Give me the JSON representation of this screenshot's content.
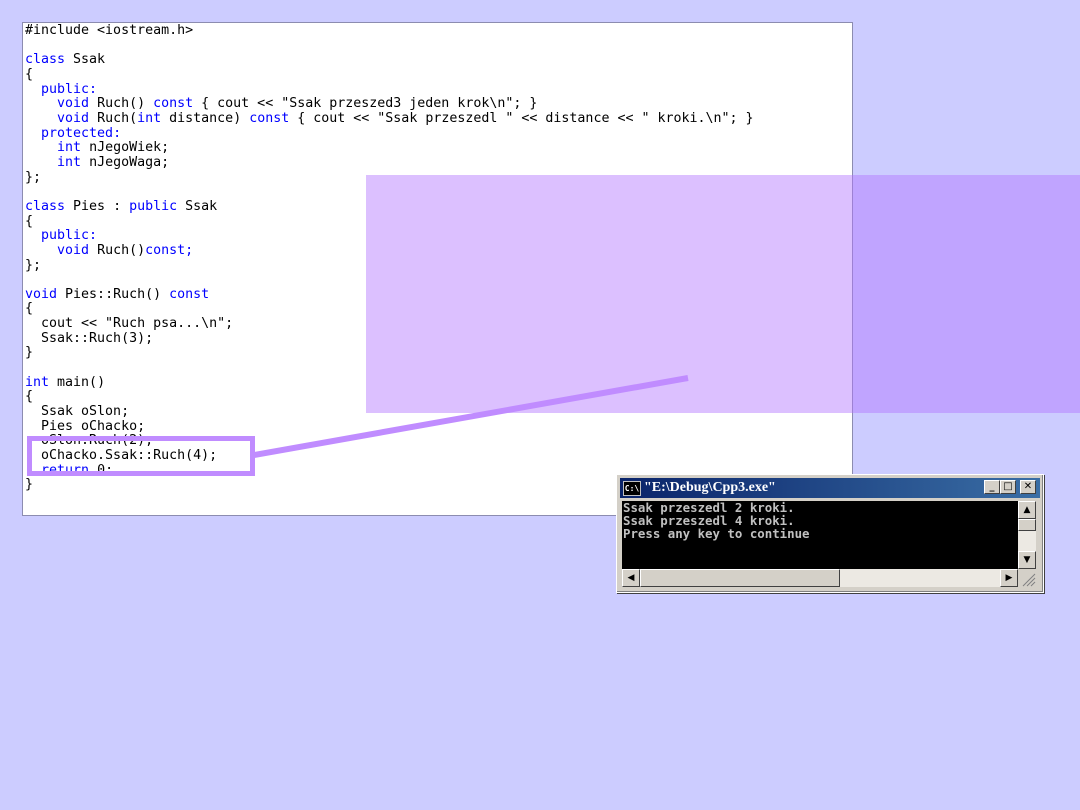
{
  "code_editor": {
    "lines": [
      [
        {
          "t": "#include <iostream.h>",
          "k": false
        }
      ],
      [
        {
          "t": "",
          "k": false
        }
      ],
      [
        {
          "t": "class",
          "k": true
        },
        {
          "t": " Ssak",
          "k": false
        }
      ],
      [
        {
          "t": "{",
          "k": false
        }
      ],
      [
        {
          "t": "  ",
          "k": false
        },
        {
          "t": "public:",
          "k": true
        }
      ],
      [
        {
          "t": "    ",
          "k": false
        },
        {
          "t": "void",
          "k": true
        },
        {
          "t": " Ruch() ",
          "k": false
        },
        {
          "t": "const",
          "k": true
        },
        {
          "t": " { cout << \"Ssak przeszed3 jeden krok\\n\"; }",
          "k": false
        }
      ],
      [
        {
          "t": "    ",
          "k": false
        },
        {
          "t": "void",
          "k": true
        },
        {
          "t": " Ruch(",
          "k": false
        },
        {
          "t": "int",
          "k": true
        },
        {
          "t": " distance) ",
          "k": false
        },
        {
          "t": "const",
          "k": true
        },
        {
          "t": " { cout << \"Ssak przeszedl \" << distance << \" kroki.\\n\"; }",
          "k": false
        }
      ],
      [
        {
          "t": "  ",
          "k": false
        },
        {
          "t": "protected:",
          "k": true
        }
      ],
      [
        {
          "t": "    ",
          "k": false
        },
        {
          "t": "int",
          "k": true
        },
        {
          "t": " nJegoWiek;",
          "k": false
        }
      ],
      [
        {
          "t": "    ",
          "k": false
        },
        {
          "t": "int",
          "k": true
        },
        {
          "t": " nJegoWaga;",
          "k": false
        }
      ],
      [
        {
          "t": "};",
          "k": false
        }
      ],
      [
        {
          "t": "",
          "k": false
        }
      ],
      [
        {
          "t": "class",
          "k": true
        },
        {
          "t": " Pies : ",
          "k": false
        },
        {
          "t": "public",
          "k": true
        },
        {
          "t": " Ssak",
          "k": false
        }
      ],
      [
        {
          "t": "{",
          "k": false
        }
      ],
      [
        {
          "t": "  ",
          "k": false
        },
        {
          "t": "public:",
          "k": true
        }
      ],
      [
        {
          "t": "    ",
          "k": false
        },
        {
          "t": "void",
          "k": true
        },
        {
          "t": " Ruch()",
          "k": false
        },
        {
          "t": "const;",
          "k": true
        }
      ],
      [
        {
          "t": "};",
          "k": false
        }
      ],
      [
        {
          "t": "",
          "k": false
        }
      ],
      [
        {
          "t": "void",
          "k": true
        },
        {
          "t": " Pies::Ruch() ",
          "k": false
        },
        {
          "t": "const",
          "k": true
        }
      ],
      [
        {
          "t": "{",
          "k": false
        }
      ],
      [
        {
          "t": "  cout << \"Ruch psa...\\n\";",
          "k": false
        }
      ],
      [
        {
          "t": "  Ssak::Ruch(3);",
          "k": false
        }
      ],
      [
        {
          "t": "}",
          "k": false
        }
      ],
      [
        {
          "t": "",
          "k": false
        }
      ],
      [
        {
          "t": "int",
          "k": true
        },
        {
          "t": " main()",
          "k": false
        }
      ],
      [
        {
          "t": "{",
          "k": false
        }
      ],
      [
        {
          "t": "  Ssak oSlon;",
          "k": false
        }
      ],
      [
        {
          "t": "  Pies oChacko;",
          "k": false
        }
      ],
      [
        {
          "t": "  oSlon.Ruch(2);",
          "k": false
        }
      ],
      [
        {
          "t": "  oChacko.Ssak::Ruch(4);",
          "k": false
        }
      ],
      [
        {
          "t": "  ",
          "k": false
        },
        {
          "t": "return",
          "k": true
        },
        {
          "t": " 0;",
          "k": false
        }
      ],
      [
        {
          "t": "}",
          "k": false
        }
      ]
    ]
  },
  "colors": {
    "background": "#ccccff",
    "keyword": "#0000ff",
    "overlay": "#b274ff",
    "highlight": "#c08cff"
  },
  "console_window": {
    "title": "\"E:\\Debug\\Cpp3.exe\"",
    "icon_text": "C:\\",
    "output": "Ssak przeszedl 2 kroki.\nSsak przeszedl 4 kroki.\nPress any key to continue",
    "minimize_glyph": "_",
    "maximize_glyph": "□",
    "close_glyph": "✕"
  }
}
